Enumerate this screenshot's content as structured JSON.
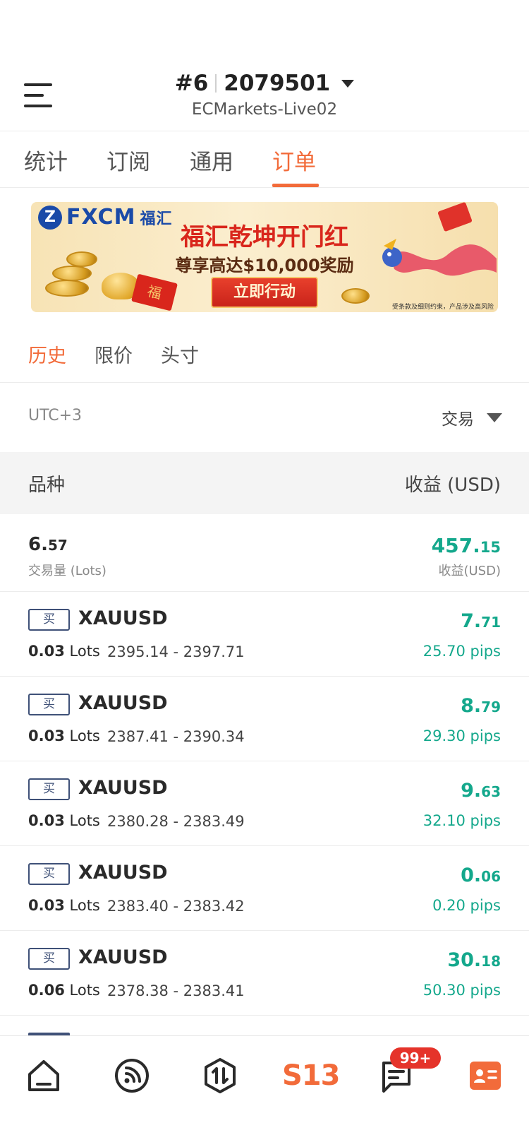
{
  "header": {
    "account_index": "#6",
    "account_number": "2079501",
    "server": "ECMarkets-Live02"
  },
  "tabs": [
    {
      "label": "统计",
      "active": false
    },
    {
      "label": "订阅",
      "active": false
    },
    {
      "label": "通用",
      "active": false
    },
    {
      "label": "订单",
      "active": true
    }
  ],
  "banner": {
    "brand": "FXCM",
    "brand_cn": "福汇",
    "title": "福汇乾坤开门红",
    "subtitle": "尊享高达$10,000奖励",
    "cta": "立即行动",
    "envelope_char": "福",
    "footnote": "受条款及细则约束，产品涉及高风险"
  },
  "subtabs": [
    {
      "label": "历史",
      "active": true
    },
    {
      "label": "限价",
      "active": false
    },
    {
      "label": "头寸",
      "active": false
    }
  ],
  "filter": {
    "timezone": "UTC+3",
    "type_label": "交易"
  },
  "columns": {
    "left": "品种",
    "right": "收益 (USD)"
  },
  "summary": {
    "lots_int": "6.",
    "lots_dec": "57",
    "lots_label": "交易量 (Lots)",
    "profit_int": "457.",
    "profit_dec": "15",
    "profit_label": "收益(USD)"
  },
  "orders": [
    {
      "side": "买",
      "symbol": "XAUUSD",
      "lots": "0.03",
      "lots_unit": "Lots",
      "prices": "2395.14 - 2397.71",
      "profit_int": "7.",
      "profit_dec": "71",
      "pips": "25.70 pips"
    },
    {
      "side": "买",
      "symbol": "XAUUSD",
      "lots": "0.03",
      "lots_unit": "Lots",
      "prices": "2387.41 - 2390.34",
      "profit_int": "8.",
      "profit_dec": "79",
      "pips": "29.30 pips"
    },
    {
      "side": "买",
      "symbol": "XAUUSD",
      "lots": "0.03",
      "lots_unit": "Lots",
      "prices": "2380.28 - 2383.49",
      "profit_int": "9.",
      "profit_dec": "63",
      "pips": "32.10 pips"
    },
    {
      "side": "买",
      "symbol": "XAUUSD",
      "lots": "0.03",
      "lots_unit": "Lots",
      "prices": "2383.40 - 2383.42",
      "profit_int": "0.",
      "profit_dec": "06",
      "pips": "0.20 pips"
    },
    {
      "side": "买",
      "symbol": "XAUUSD",
      "lots": "0.06",
      "lots_unit": "Lots",
      "prices": "2378.38 - 2383.41",
      "profit_int": "30.",
      "profit_dec": "18",
      "pips": "50.30 pips"
    }
  ],
  "bottom_nav": {
    "items": [
      {
        "icon": "home-icon"
      },
      {
        "icon": "signal-feed-icon"
      },
      {
        "icon": "trade-icon"
      },
      {
        "icon": "s13-logo-icon",
        "label": "S13"
      },
      {
        "icon": "messages-icon",
        "badge": "99+"
      },
      {
        "icon": "profile-card-icon"
      }
    ]
  },
  "colors": {
    "accent": "#f26b3a",
    "profit": "#14a88c",
    "badge": "#e5332a",
    "side_badge": "#3f5178"
  }
}
